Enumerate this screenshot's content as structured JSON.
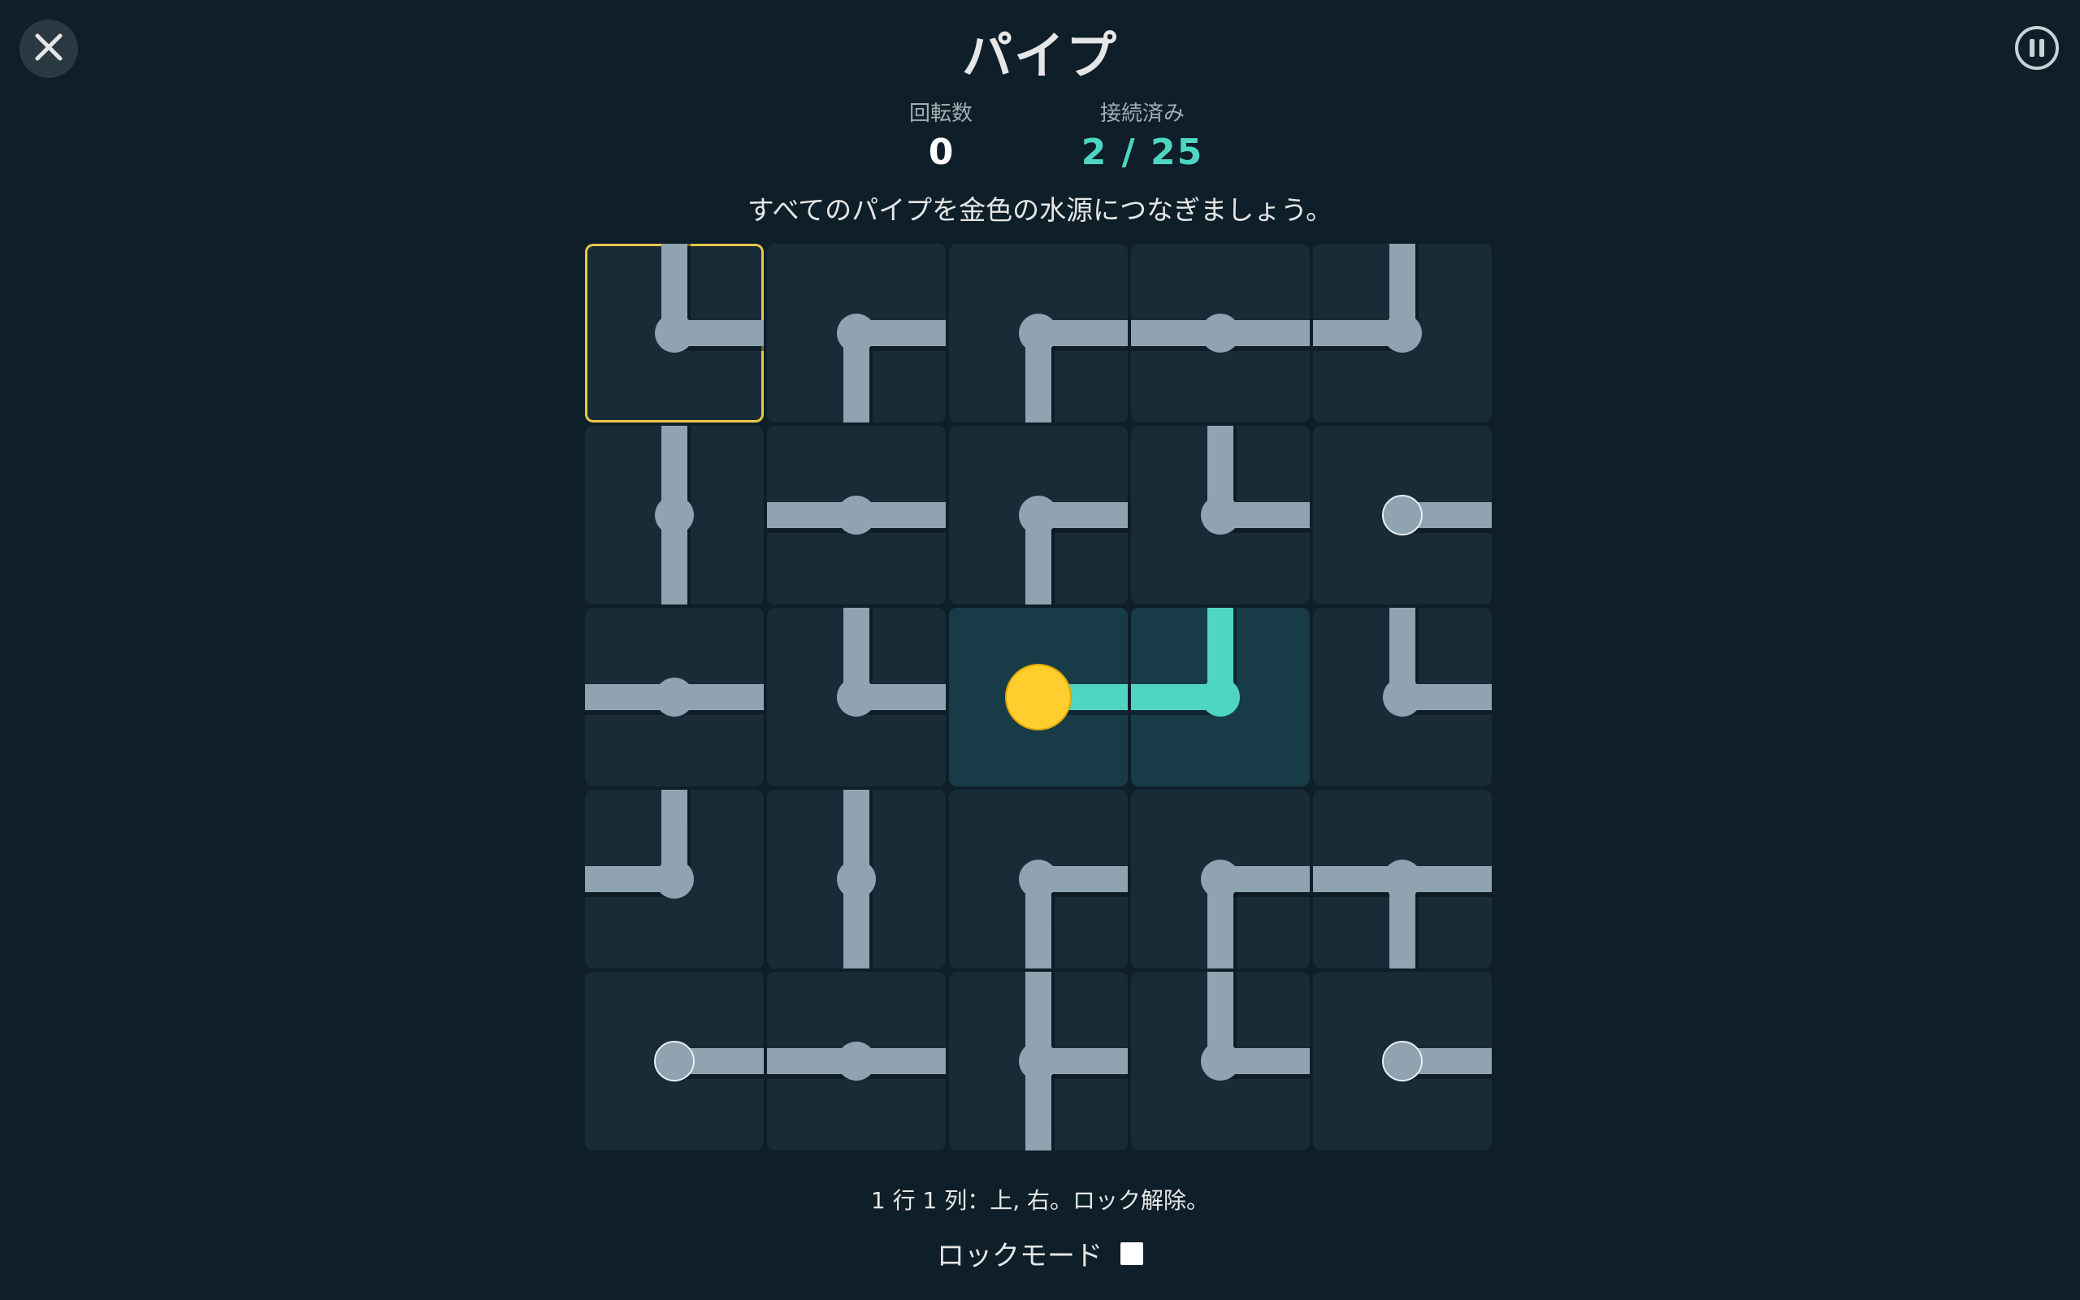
{
  "title": "パイプ",
  "stats": {
    "rotations_label": "回転数",
    "rotations_value": "0",
    "connected_label": "接続済み",
    "connected_value": "2 / 25"
  },
  "instruction": "すべてのパイプを金色の水源につなぎましょう。",
  "status": "1 行 1 列：上, 右。ロック解除。",
  "lock_mode": {
    "label": "ロックモード",
    "checked": false
  },
  "icons": {
    "close": "close-icon",
    "pause": "pause-icon"
  },
  "colors": {
    "background": "#0f1f29",
    "tile": "#192b36",
    "tile_connected": "#173c48",
    "pipe": "#8fa3b1",
    "pipe_connected": "#4fd6c3",
    "source": "#ffcd2e",
    "selection": "#e8c84a"
  },
  "board": {
    "rows": 5,
    "cols": 5,
    "selected": [
      0,
      0
    ],
    "source": [
      2,
      2
    ],
    "tiles": [
      [
        {
          "dirs": [
            "up",
            "right"
          ],
          "kind": "pipe",
          "connected": false
        },
        {
          "dirs": [
            "right",
            "down"
          ],
          "kind": "pipe",
          "connected": false
        },
        {
          "dirs": [
            "right",
            "down"
          ],
          "kind": "pipe",
          "connected": false
        },
        {
          "dirs": [
            "left",
            "right"
          ],
          "kind": "pipe",
          "connected": false
        },
        {
          "dirs": [
            "up",
            "left"
          ],
          "kind": "pipe",
          "connected": false
        }
      ],
      [
        {
          "dirs": [
            "up",
            "down"
          ],
          "kind": "pipe",
          "connected": false
        },
        {
          "dirs": [
            "left",
            "right"
          ],
          "kind": "pipe",
          "connected": false
        },
        {
          "dirs": [
            "right",
            "down"
          ],
          "kind": "pipe",
          "connected": false
        },
        {
          "dirs": [
            "up",
            "right"
          ],
          "kind": "pipe",
          "connected": false
        },
        {
          "dirs": [
            "right"
          ],
          "kind": "endpoint",
          "connected": false
        }
      ],
      [
        {
          "dirs": [
            "left",
            "right"
          ],
          "kind": "pipe",
          "connected": false
        },
        {
          "dirs": [
            "up",
            "right"
          ],
          "kind": "pipe",
          "connected": false
        },
        {
          "dirs": [
            "right"
          ],
          "kind": "source",
          "connected": true
        },
        {
          "dirs": [
            "up",
            "left"
          ],
          "kind": "pipe",
          "connected": true
        },
        {
          "dirs": [
            "up",
            "right"
          ],
          "kind": "pipe",
          "connected": false
        }
      ],
      [
        {
          "dirs": [
            "up",
            "left"
          ],
          "kind": "pipe",
          "connected": false
        },
        {
          "dirs": [
            "up",
            "down"
          ],
          "kind": "pipe",
          "connected": false
        },
        {
          "dirs": [
            "right",
            "down"
          ],
          "kind": "pipe",
          "connected": false
        },
        {
          "dirs": [
            "right",
            "down"
          ],
          "kind": "pipe",
          "connected": false
        },
        {
          "dirs": [
            "left",
            "right",
            "down"
          ],
          "kind": "pipe",
          "connected": false
        }
      ],
      [
        {
          "dirs": [
            "right"
          ],
          "kind": "endpoint",
          "connected": false
        },
        {
          "dirs": [
            "left",
            "right"
          ],
          "kind": "pipe",
          "connected": false
        },
        {
          "dirs": [
            "up",
            "right",
            "down"
          ],
          "kind": "pipe",
          "connected": false
        },
        {
          "dirs": [
            "up",
            "right"
          ],
          "kind": "pipe",
          "connected": false
        },
        {
          "dirs": [
            "right"
          ],
          "kind": "endpoint",
          "connected": false
        }
      ]
    ]
  }
}
